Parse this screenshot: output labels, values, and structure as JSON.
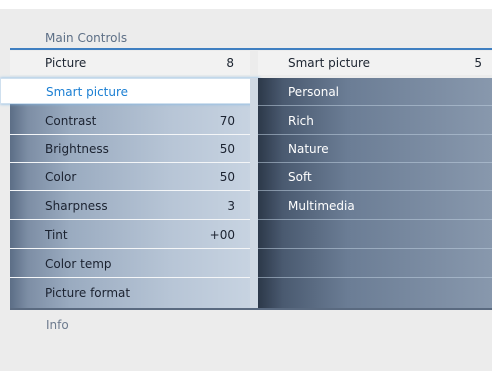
{
  "menu": {
    "title": "Main Controls",
    "left_header": {
      "label": "Picture",
      "value": "8"
    },
    "right_header": {
      "label": "Smart picture",
      "value": "5"
    },
    "left_items": [
      {
        "label": "Smart picture",
        "value": ""
      },
      {
        "label": "Contrast",
        "value": "70"
      },
      {
        "label": "Brightness",
        "value": "50"
      },
      {
        "label": "Color",
        "value": "50"
      },
      {
        "label": "Sharpness",
        "value": "3"
      },
      {
        "label": "Tint",
        "value": "+00"
      },
      {
        "label": "Color temp",
        "value": ""
      },
      {
        "label": "Picture format",
        "value": ""
      }
    ],
    "right_items": [
      {
        "label": "Personal"
      },
      {
        "label": "Rich"
      },
      {
        "label": "Nature"
      },
      {
        "label": "Soft"
      },
      {
        "label": "Multimedia"
      },
      {
        "label": ""
      },
      {
        "label": ""
      },
      {
        "label": ""
      }
    ],
    "footer": "Info"
  },
  "colors": {
    "accent": "#1b7fd3",
    "rule": "#3f7fc1"
  }
}
